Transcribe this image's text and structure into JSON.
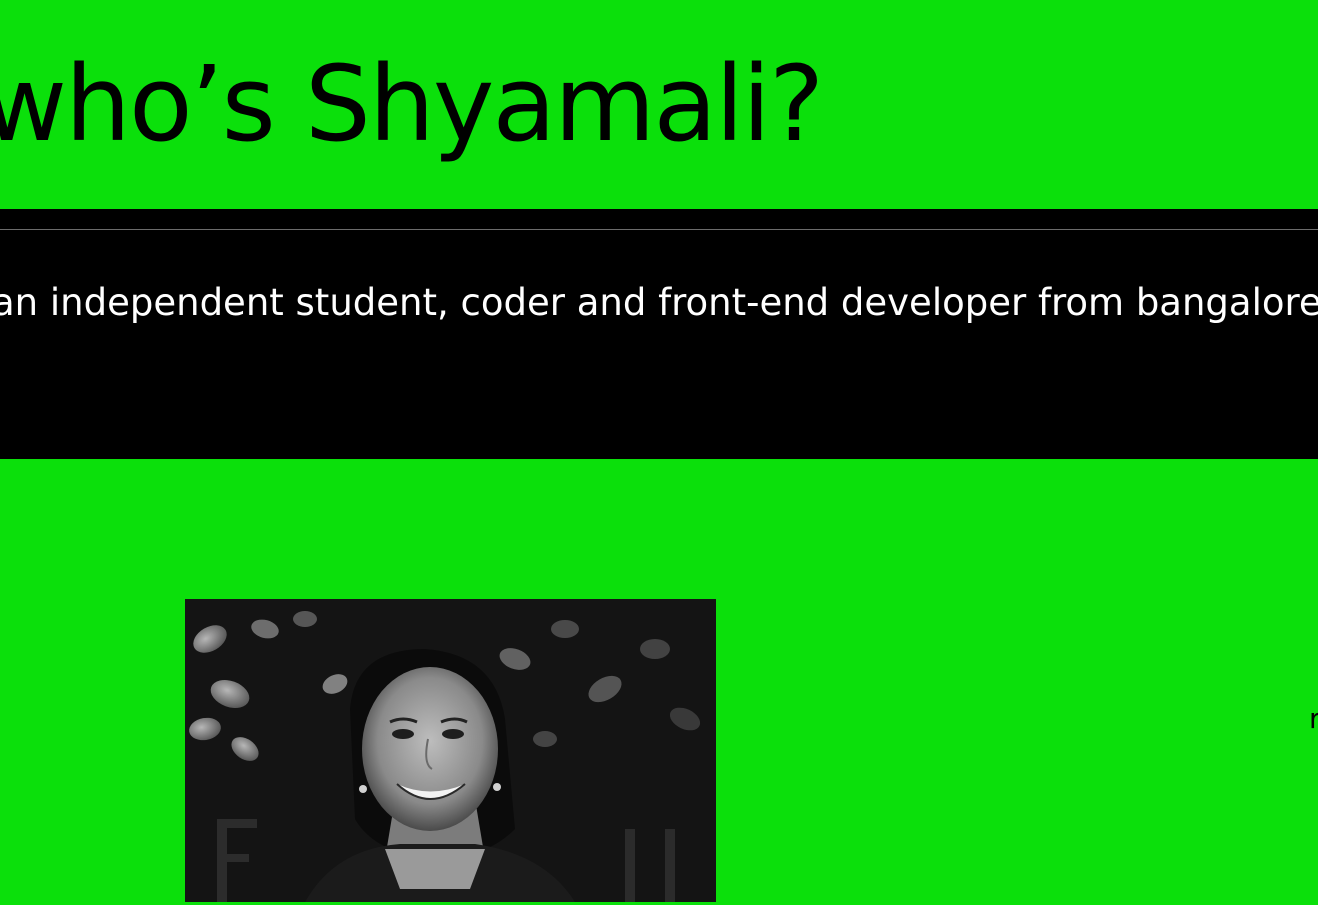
{
  "hero": {
    "title": "who’s Shyamali?"
  },
  "intro": {
    "text": "an independent student, coder and front-end developer from bangalore wh"
  },
  "about": {
    "side_text": "r"
  },
  "colors": {
    "page_background": "#0be00b",
    "band_background": "#000000",
    "title_text": "#000000",
    "intro_text": "#ffffff"
  }
}
